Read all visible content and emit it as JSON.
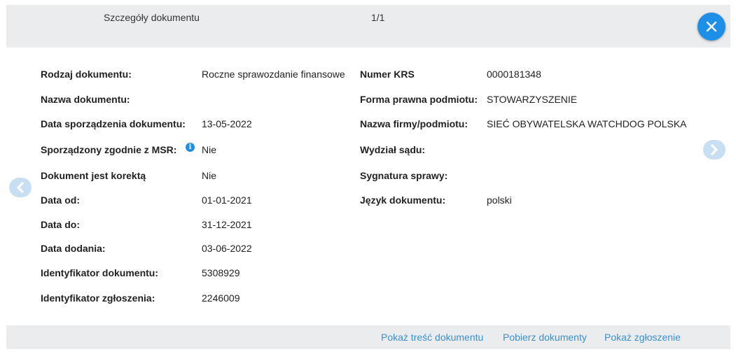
{
  "header": {
    "title": "Szczegóły dokumentu",
    "page_indicator": "1/1",
    "close_icon": "close-icon"
  },
  "left_fields": [
    {
      "label": "Rodzaj dokumentu:",
      "value": "Roczne sprawozdanie finansowe"
    },
    {
      "label": "Nazwa dokumentu:",
      "value": ""
    },
    {
      "label": "Data sporządzenia dokumentu:",
      "value": "13-05-2022"
    },
    {
      "label": "Sporządzony zgodnie z MSR:",
      "value": "Nie"
    },
    {
      "label": "Dokument jest korektą",
      "value": "Nie"
    },
    {
      "label": "Data od:",
      "value": "01-01-2021"
    },
    {
      "label": "Data do:",
      "value": "31-12-2021"
    },
    {
      "label": "Data dodania:",
      "value": "03-06-2022"
    },
    {
      "label": "Identyfikator dokumentu:",
      "value": "5308929"
    },
    {
      "label": "Identyfikator zgłoszenia:",
      "value": "2246009"
    }
  ],
  "right_fields": [
    {
      "label": "Numer KRS",
      "value": "0000181348"
    },
    {
      "label": "Forma prawna podmiotu:",
      "value": "STOWARZYSZENIE"
    },
    {
      "label": "Nazwa firmy/podmiotu:",
      "value": "SIEĆ OBYWATELSKA WATCHDOG POLSKA"
    },
    {
      "label": "Wydział sądu:",
      "value": ""
    },
    {
      "label": "Sygnatura sprawy:",
      "value": ""
    },
    {
      "label": "Język dokumentu:",
      "value": "polski"
    }
  ],
  "info_icon_glyph": "i",
  "footer": {
    "link_show_content": "Pokaż treść dokumentu",
    "link_download": "Pobierz dokumenty",
    "link_show_submission": "Pokaż zgłoszenie"
  },
  "colors": {
    "accent": "#1e8fe6",
    "link": "#3a8fcf",
    "panel_bg": "#ebecee",
    "arrow_bg": "#c8dff3"
  }
}
